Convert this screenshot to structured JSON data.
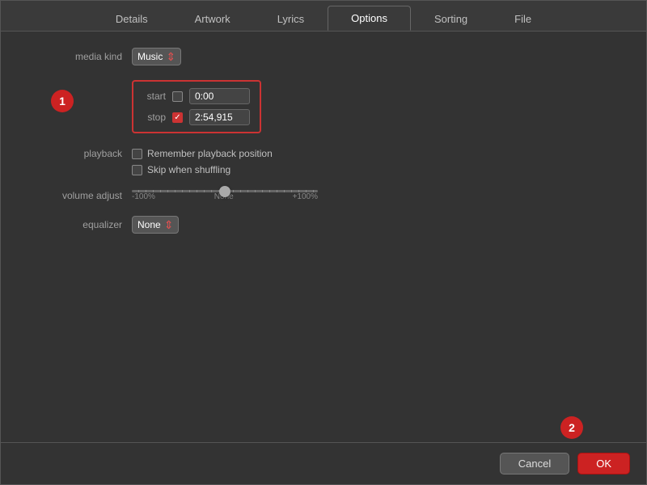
{
  "tabs": [
    {
      "id": "details",
      "label": "Details",
      "active": false
    },
    {
      "id": "artwork",
      "label": "Artwork",
      "active": false
    },
    {
      "id": "lyrics",
      "label": "Lyrics",
      "active": false
    },
    {
      "id": "options",
      "label": "Options",
      "active": true
    },
    {
      "id": "sorting",
      "label": "Sorting",
      "active": false
    },
    {
      "id": "file",
      "label": "File",
      "active": false
    }
  ],
  "form": {
    "media_kind_label": "media kind",
    "media_kind_value": "Music",
    "start_label": "start",
    "start_value": "0:00",
    "stop_label": "stop",
    "stop_value": "2:54,915",
    "playback_label": "playback",
    "remember_playback_label": "Remember playback position",
    "skip_shuffle_label": "Skip when shuffling",
    "volume_adjust_label": "volume adjust",
    "volume_min": "-100%",
    "volume_none": "None",
    "volume_max": "+100%",
    "equalizer_label": "equalizer",
    "equalizer_value": "None"
  },
  "badges": {
    "one": "1",
    "two": "2"
  },
  "footer": {
    "cancel_label": "Cancel",
    "ok_label": "OK"
  }
}
